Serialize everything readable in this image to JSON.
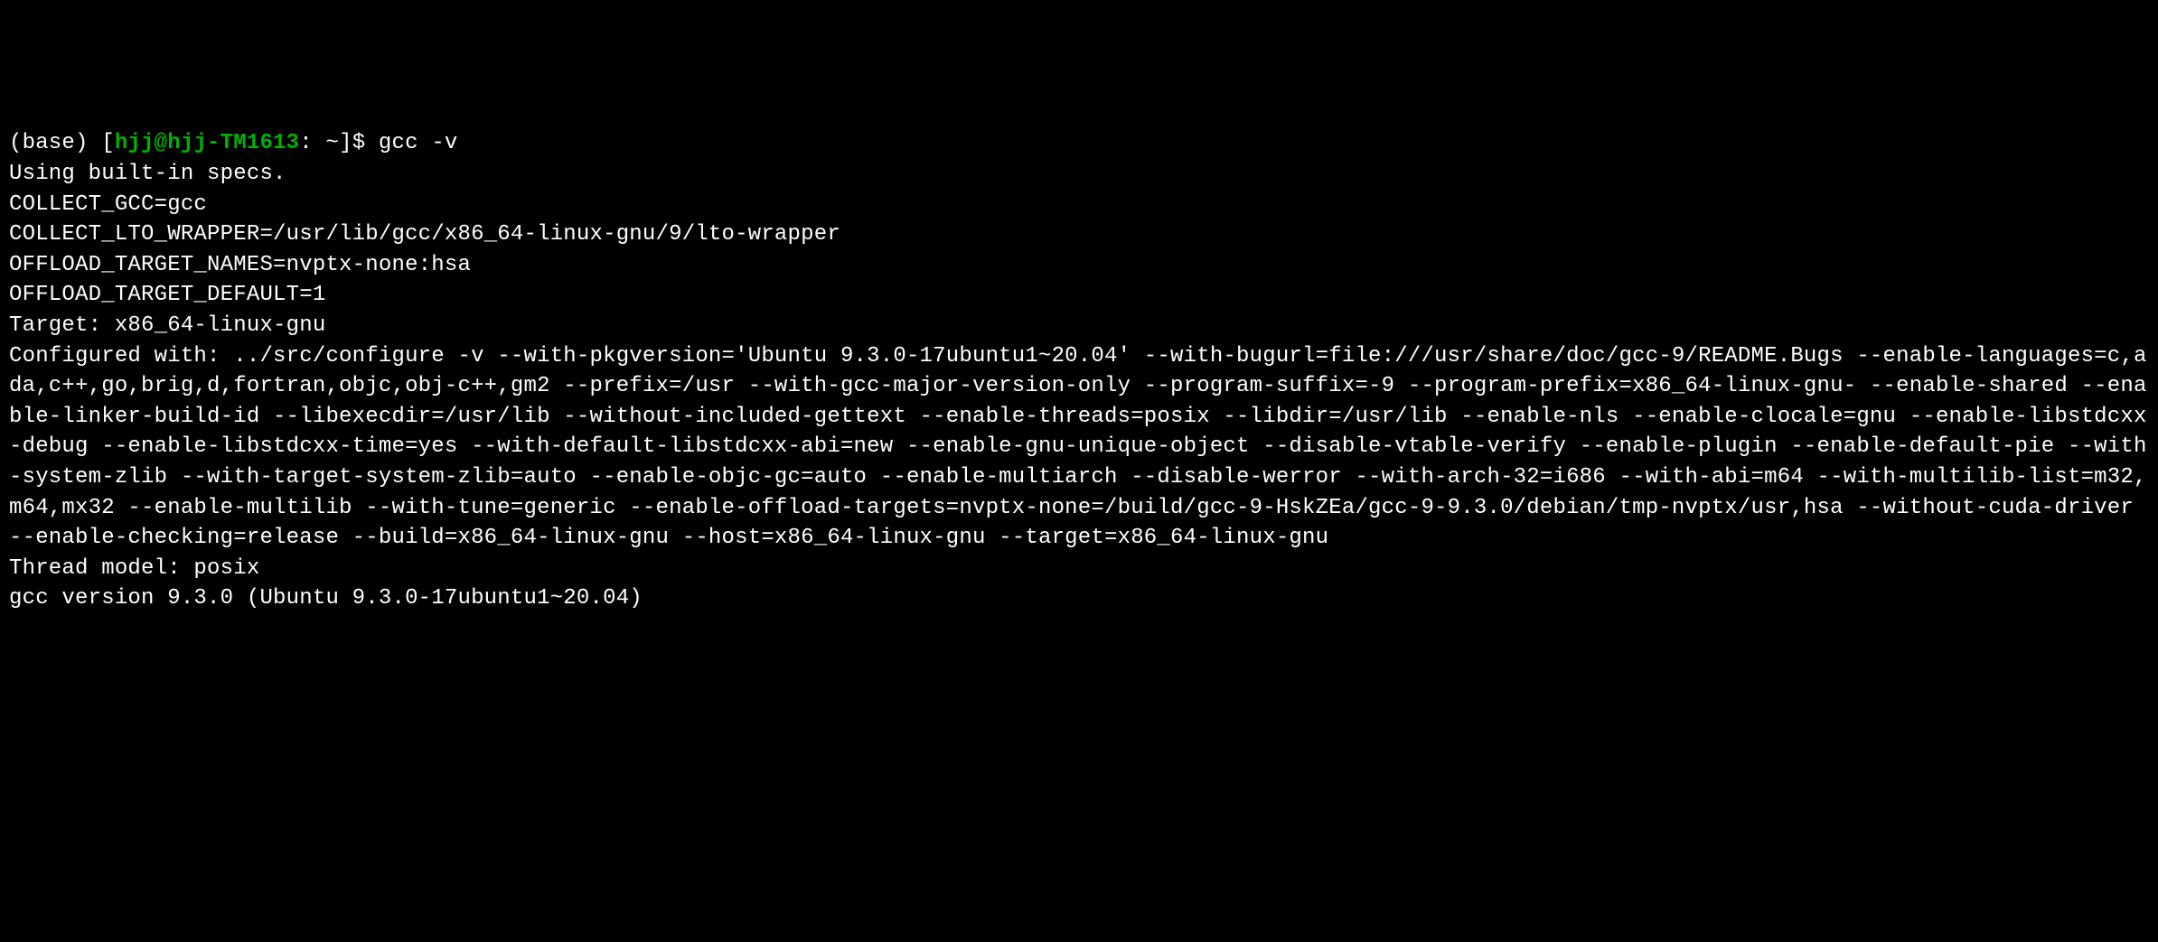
{
  "prompt": {
    "env": "(base) ",
    "open": "[",
    "userhost": "hjj@hjj-TM1613",
    "sep": ": ",
    "path": "~",
    "close": "]$ ",
    "command": "gcc -v"
  },
  "output": "Using built-in specs.\nCOLLECT_GCC=gcc\nCOLLECT_LTO_WRAPPER=/usr/lib/gcc/x86_64-linux-gnu/9/lto-wrapper\nOFFLOAD_TARGET_NAMES=nvptx-none:hsa\nOFFLOAD_TARGET_DEFAULT=1\nTarget: x86_64-linux-gnu\nConfigured with: ../src/configure -v --with-pkgversion='Ubuntu 9.3.0-17ubuntu1~20.04' --with-bugurl=file:///usr/share/doc/gcc-9/README.Bugs --enable-languages=c,ada,c++,go,brig,d,fortran,objc,obj-c++,gm2 --prefix=/usr --with-gcc-major-version-only --program-suffix=-9 --program-prefix=x86_64-linux-gnu- --enable-shared --enable-linker-build-id --libexecdir=/usr/lib --without-included-gettext --enable-threads=posix --libdir=/usr/lib --enable-nls --enable-clocale=gnu --enable-libstdcxx-debug --enable-libstdcxx-time=yes --with-default-libstdcxx-abi=new --enable-gnu-unique-object --disable-vtable-verify --enable-plugin --enable-default-pie --with-system-zlib --with-target-system-zlib=auto --enable-objc-gc=auto --enable-multiarch --disable-werror --with-arch-32=i686 --with-abi=m64 --with-multilib-list=m32,m64,mx32 --enable-multilib --with-tune=generic --enable-offload-targets=nvptx-none=/build/gcc-9-HskZEa/gcc-9-9.3.0/debian/tmp-nvptx/usr,hsa --without-cuda-driver --enable-checking=release --build=x86_64-linux-gnu --host=x86_64-linux-gnu --target=x86_64-linux-gnu\nThread model: posix\ngcc version 9.3.0 (Ubuntu 9.3.0-17ubuntu1~20.04) "
}
